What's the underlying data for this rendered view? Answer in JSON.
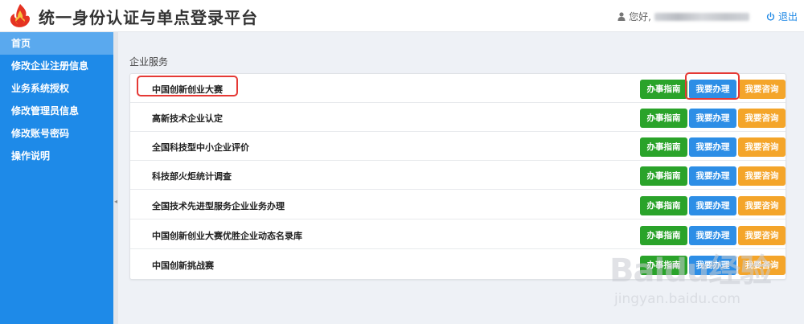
{
  "header": {
    "title": "统一身份认证与单点登录平台",
    "greeting": "您好,",
    "logout_label": "退出",
    "colors": {
      "title": "#333333",
      "link": "#1e88e5"
    }
  },
  "sidebar": {
    "color": "#1e8ae8",
    "active_color": "#5aa9ee",
    "items": [
      {
        "label": "首页",
        "active": true
      },
      {
        "label": "修改企业注册信息"
      },
      {
        "label": "业务系统授权"
      },
      {
        "label": "修改管理员信息"
      },
      {
        "label": "修改账号密码"
      },
      {
        "label": "操作说明"
      }
    ]
  },
  "main": {
    "section_title": "企业服务",
    "buttons": {
      "guide": "办事指南",
      "handle": "我要办理",
      "consult": "我要咨询"
    },
    "button_colors": {
      "guide": "#2aa32a",
      "handle": "#2d8ee6",
      "consult": "#f4a52a"
    },
    "services": [
      {
        "name": "中国创新创业大赛"
      },
      {
        "name": "高新技术企业认定"
      },
      {
        "name": "全国科技型中小企业评价"
      },
      {
        "name": "科技部火炬统计调查"
      },
      {
        "name": "全国技术先进型服务企业业务办理"
      },
      {
        "name": "中国创新创业大赛优胜企业动态名录库"
      },
      {
        "name": "中国创新挑战赛"
      }
    ]
  },
  "watermark": {
    "main": "Baidu经验",
    "sub": "jingyan.baidu.com"
  },
  "icons": {
    "logo": "flame-logo-icon",
    "user": "user-icon",
    "logout": "power-icon",
    "collapse": "chevron-left-icon"
  }
}
